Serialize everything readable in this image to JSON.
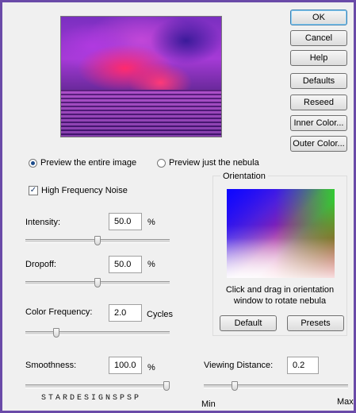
{
  "buttons": {
    "ok": "OK",
    "cancel": "Cancel",
    "help": "Help",
    "defaults": "Defaults",
    "reseed": "Reseed",
    "inner_color": "Inner Color...",
    "outer_color": "Outer Color..."
  },
  "preview_mode": {
    "entire": "Preview the entire image",
    "nebula": "Preview just the nebula",
    "selected": "entire"
  },
  "high_frequency": {
    "label": "High Frequency Noise",
    "checked": true,
    "mark": "✓"
  },
  "intensity": {
    "label": "Intensity:",
    "value": "50.0",
    "unit": "%",
    "slider_fraction": 0.5
  },
  "dropoff": {
    "label": "Dropoff:",
    "value": "50.0",
    "unit": "%",
    "slider_fraction": 0.5
  },
  "color_frequency": {
    "label": "Color Frequency:",
    "value": "2.0",
    "unit": "Cycles",
    "slider_fraction": 0.2
  },
  "smoothness": {
    "label": "Smoothness:",
    "value": "100.0",
    "unit": "%",
    "slider_fraction": 1.0
  },
  "orientation": {
    "title": "Orientation",
    "hint_line1": "Click and drag in orientation",
    "hint_line2": "window to rotate nebula",
    "default_button": "Default",
    "presets_button": "Presets"
  },
  "viewing_distance": {
    "label": "Viewing Distance:",
    "value": "0.2",
    "min_label": "Min",
    "max_label": "Max",
    "slider_fraction": 0.2
  },
  "watermark": "STARDESIGNSPSP"
}
